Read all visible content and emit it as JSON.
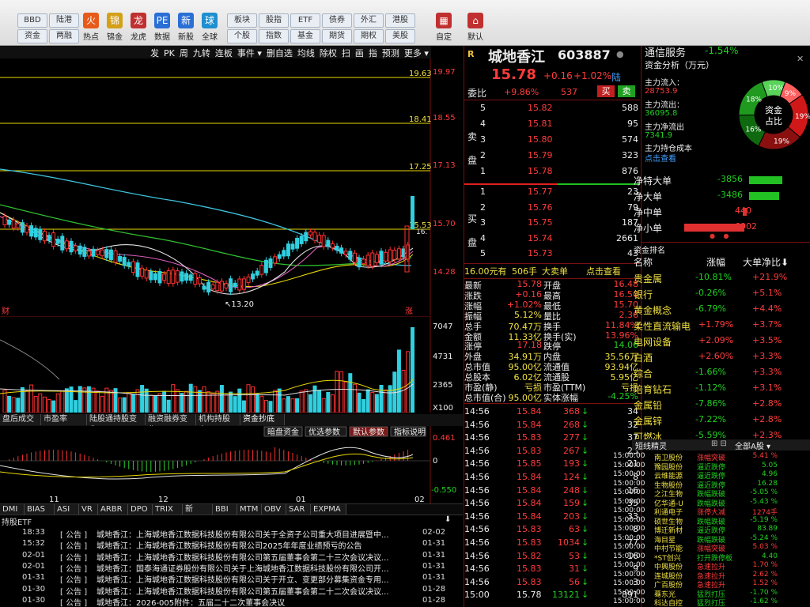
{
  "toolbar": {
    "row1": [
      "BBD",
      "陆港",
      "板块",
      "股指",
      "ETF",
      "债券",
      "外汇",
      "港股"
    ],
    "row2": [
      "资金",
      "两融",
      "个股",
      "指数",
      "基金",
      "期货",
      "期权",
      "美股"
    ],
    "big": [
      {
        "label": "热点",
        "icon": "火"
      },
      {
        "label": "锦金",
        "icon": "锦"
      },
      {
        "label": "龙虎",
        "icon": "龙"
      },
      {
        "label": "数据",
        "icon": "PE"
      },
      {
        "label": "新股",
        "icon": "新"
      },
      {
        "label": "全球",
        "icon": "球"
      }
    ],
    "right": [
      {
        "label": "自定",
        "icon": "▦"
      },
      {
        "label": "默认",
        "icon": "⌂"
      }
    ]
  },
  "chart_toolbar": [
    "发",
    "PK",
    "周",
    "九转",
    "连板",
    "事件 ▾",
    "删自选",
    "均线",
    "除权",
    "扫",
    "画",
    "指",
    "预测",
    "更多 ▾"
  ],
  "kline": {
    "price_levels": [
      {
        "value": "19.63",
        "axis": "19.97"
      },
      {
        "value": "18.41",
        "axis": "18.55"
      },
      {
        "value": "17.25",
        "axis": "17.13"
      },
      {
        "value": "15.53",
        "axis": "15.70"
      }
    ],
    "axis_low": "14.28",
    "low_marker": "13.20",
    "right_marker": "16.",
    "bottom_left": "财",
    "bottom_right": "涨"
  },
  "volume": {
    "axis": [
      "7047",
      "4731",
      "2365",
      "X100"
    ]
  },
  "indicator_tabs": [
    "盘后成交",
    "市盈率(ttm)",
    "陆股通持股变化",
    "融资融券变化",
    "机构持股变",
    "资金抄底"
  ],
  "macd": {
    "buttons": [
      "暗盘资金",
      "优选参数",
      "默认参数",
      "指标说明"
    ],
    "axis": [
      "0.461",
      "0",
      "-0.550"
    ],
    "dates": [
      "11",
      "12",
      "01",
      "02"
    ]
  },
  "indicator_bar": [
    "DMI",
    "BIAS",
    "ASI",
    "VR",
    "ARBR",
    "DPO",
    "TRIX",
    "新DMA",
    "BBI",
    "MTM",
    "OBV",
    "SAR",
    "EXPMA"
  ],
  "news": {
    "header": "持股ETF",
    "items": [
      {
        "time": "18:33",
        "tag": "公告",
        "text": "城地香江：上海城地香江数据科技股份有限公司关于全资子公司重大项目进展暨中...",
        "date": "02-02"
      },
      {
        "time": "15:32",
        "tag": "公告",
        "text": "城地香江：上海城地香江数据科技股份有限公司2025年年度业绩预亏的公告",
        "date": "01-31"
      },
      {
        "time": "02-01",
        "tag": "公告",
        "text": "城地香江：上海城地香江数据科技股份有限公司第五届董事会第二十三次会议决议...",
        "date": "01-31"
      },
      {
        "time": "02-01",
        "tag": "公告",
        "text": "城地香江：国泰海通证券股份有限公司关于上海城地香江数据科技股份有限公司开...",
        "date": "01-31"
      },
      {
        "time": "01-31",
        "tag": "公告",
        "text": "城地香江：上海城地香江数据科技股份有限公司关于开立、变更部分募集资金专用...",
        "date": "01-31"
      },
      {
        "time": "01-30",
        "tag": "公告",
        "text": "城地香江：上海城地香江数据科技股份有限公司第五届董事会第二十二次会议决议...",
        "date": "01-28"
      },
      {
        "time": "01-30",
        "tag": "公告",
        "text": "城地香江：2026-005附件：五届二十二次董事会决议",
        "date": "01-28"
      }
    ]
  },
  "quote": {
    "r": "R",
    "name": "城地香江",
    "code": "603887",
    "price": "15.78",
    "change": "+0.16",
    "pct": "+1.02%",
    "tag": "陆",
    "weibi_label": "委比",
    "weibi": "+9.86%",
    "weicha": "537",
    "buy": "买",
    "sell": "卖",
    "sell_label": "卖盘",
    "buy_label": "买盘",
    "asks": [
      {
        "n": "5",
        "p": "15.82",
        "v": "588"
      },
      {
        "n": "4",
        "p": "15.81",
        "v": "95"
      },
      {
        "n": "3",
        "p": "15.80",
        "v": "574"
      },
      {
        "n": "2",
        "p": "15.79",
        "v": "323"
      },
      {
        "n": "1",
        "p": "15.78",
        "v": "876"
      }
    ],
    "bids": [
      {
        "n": "1",
        "p": "15.77",
        "v": "23"
      },
      {
        "n": "2",
        "p": "15.76",
        "v": "79"
      },
      {
        "n": "3",
        "p": "15.75",
        "v": "187"
      },
      {
        "n": "4",
        "p": "15.74",
        "v": "2661"
      },
      {
        "n": "5",
        "p": "15.73",
        "v": "43"
      }
    ],
    "big_order": {
      "price": "16.00元有",
      "qty": "506手",
      "label": "大卖单",
      "link": "点击查看"
    },
    "stats": [
      [
        "最新",
        "15.78",
        "开盘",
        "16.48"
      ],
      [
        "涨跌",
        "+0.16",
        "最高",
        "16.50"
      ],
      [
        "涨幅",
        "+1.02%",
        "最低",
        "15.70"
      ],
      [
        "振幅",
        "5.12%",
        "量比",
        "2.36"
      ],
      [
        "总手",
        "70.47万",
        "换手",
        "11.84%"
      ],
      [
        "金额",
        "11.33亿",
        "换手(实)",
        "13.96%"
      ],
      [
        "涨停",
        "17.18",
        "跌停",
        "14.06"
      ],
      [
        "外盘",
        "34.91万",
        "内盘",
        "35.56万"
      ],
      [
        "总市值",
        "95.00亿",
        "流通值",
        "93.94亿"
      ],
      [
        "总股本",
        "6.02亿",
        "流通股",
        "5.95亿"
      ],
      [
        "市盈(静)",
        "亏损",
        "市盈(TTM)",
        "亏损"
      ],
      [
        "总市值(合)",
        "95.00亿",
        "实体涨幅",
        "-4.25%"
      ]
    ],
    "ticks": [
      [
        "14:56",
        "15.84",
        "368",
        "34"
      ],
      [
        "14:56",
        "15.84",
        "268",
        "32"
      ],
      [
        "14:56",
        "15.83",
        "277",
        "37"
      ],
      [
        "14:56",
        "15.83",
        "267",
        "23"
      ],
      [
        "14:56",
        "15.85",
        "193",
        "21"
      ],
      [
        "14:56",
        "15.84",
        "124",
        "8"
      ],
      [
        "14:56",
        "15.84",
        "248",
        "16"
      ],
      [
        "14:56",
        "15.84",
        "159",
        "35"
      ],
      [
        "14:56",
        "15.84",
        "203",
        "33"
      ],
      [
        "14:56",
        "15.83",
        "63",
        "8"
      ],
      [
        "14:56",
        "15.83",
        "1034",
        "77"
      ],
      [
        "14:56",
        "15.82",
        "53",
        "16"
      ],
      [
        "14:56",
        "15.83",
        "31",
        "9"
      ],
      [
        "14:56",
        "15.83",
        "56",
        "3"
      ],
      [
        "15:00",
        "15.78",
        "13121",
        "891"
      ]
    ]
  },
  "right": {
    "sector": "通信服务",
    "sector_pct": "-1.54%",
    "fund_title": "资金分析（万元）",
    "inflow_label": "主力流入：",
    "inflow": "28753.9",
    "outflow_label": "主力流出：",
    "outflow": "36095.8",
    "net_label": "主力净流出",
    "net": "7341.9",
    "cost_label": "主力持仓成本",
    "cost_link": "点击查看",
    "donut_center": [
      "资金",
      "占比"
    ],
    "donut_labels": [
      "10%",
      "9%",
      "19%",
      "19%",
      "16%",
      "18%"
    ],
    "flows": [
      {
        "label": "净特大单",
        "value": "-3856",
        "color": "#22c022",
        "frac": 0.55
      },
      {
        "label": "净大单",
        "value": "-3486",
        "color": "#22c022",
        "frac": 0.5
      },
      {
        "label": "净中单",
        "value": "440",
        "color": "#e03030",
        "frac": 0.06
      },
      {
        "label": "净小单",
        "value": "6902",
        "color": "#e03030",
        "frac": 1.0
      }
    ],
    "rank_title": "资金排名",
    "rank_cols": [
      "名称",
      "涨幅",
      "大单净比"
    ],
    "rank": [
      [
        "贵金属",
        "-10.81%",
        "+21.9%"
      ],
      [
        "银行",
        "-0.26%",
        "+5.1%"
      ],
      [
        "黄金概念",
        "-6.79%",
        "+4.4%"
      ],
      [
        "柔性直流输电",
        "+1.79%",
        "+3.7%"
      ],
      [
        "电网设备",
        "+2.09%",
        "+3.5%"
      ],
      [
        "白酒",
        "+2.60%",
        "+3.3%"
      ],
      [
        "综合",
        "-1.66%",
        "+3.3%"
      ],
      [
        "培育钻石",
        "-1.12%",
        "+3.1%"
      ],
      [
        "金属铅",
        "-7.86%",
        "+2.8%"
      ],
      [
        "金属锌",
        "-7.22%",
        "+2.8%"
      ],
      [
        "可燃冰",
        "-5.59%",
        "+2.3%"
      ]
    ],
    "wire_title": "短线精灵",
    "wire_filter": "全部A股",
    "wire": [
      [
        "15:00:00",
        "南卫股份",
        "涨幅突破",
        "5.41 %"
      ],
      [
        "15:00:00",
        "豫园股份",
        "逼近跌停",
        "5.05"
      ],
      [
        "15:00:00",
        "云维能源",
        "逼近跌停",
        "4.96"
      ],
      [
        "15:00:00",
        "生物股份",
        "逼近跌停",
        "16.28"
      ],
      [
        "15:00:00",
        "之江生物",
        "跌幅跌破",
        "-5.05 %"
      ],
      [
        "15:00:00",
        "亿华通-U",
        "跌幅跌破",
        "-5.43 %"
      ],
      [
        "15:00:00",
        "利通电子",
        "涨停大减",
        "1274手"
      ],
      [
        "15:00:00",
        "硕世生物",
        "跌幅跌破",
        "-5.19 %"
      ],
      [
        "15:00:00",
        "博迁新材",
        "逼近跌停",
        "83.89"
      ],
      [
        "15:00:00",
        "海目星",
        "跌幅跌破",
        "-5.24 %"
      ],
      [
        "15:00:00",
        "中村节能",
        "涨幅突破",
        "5.03 %"
      ],
      [
        "15:00:00",
        "*ST创兴",
        "打开跌停板",
        "4.40"
      ],
      [
        "15:00:00",
        "中興股份",
        "急速拉升",
        "1.70 %"
      ],
      [
        "15:00:00",
        "连城股份",
        "急速拉升",
        "2.62 %"
      ],
      [
        "15:00:00",
        "广百股份",
        "急速拉升",
        "1.52 %"
      ],
      [
        "15:00:00",
        "蓦东光",
        "猛烈打压",
        "-1.70 %"
      ],
      [
        "15:00:00",
        "科达自控",
        "猛烈打压",
        "-1.62 %"
      ]
    ]
  }
}
